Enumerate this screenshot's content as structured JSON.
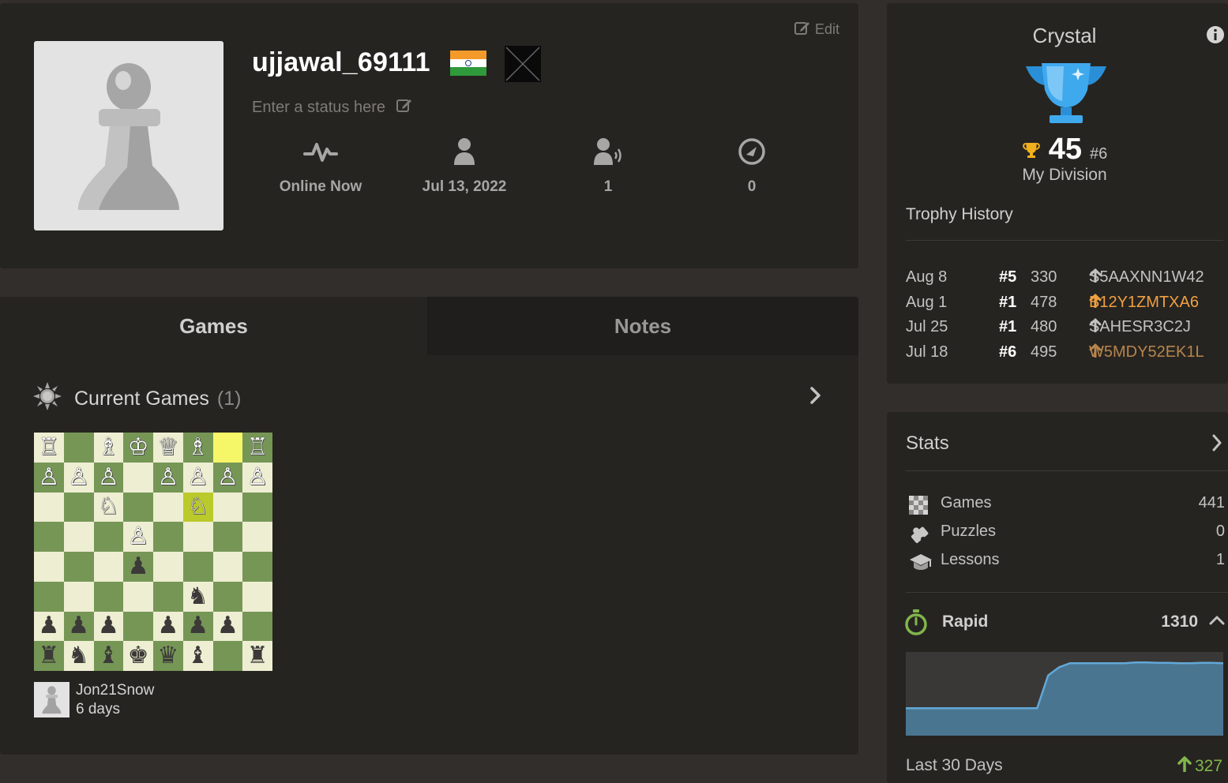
{
  "profile": {
    "edit_label": "Edit",
    "username": "ujjawal_69111",
    "status_placeholder": "Enter a status here",
    "stats": [
      {
        "icon": "activity-icon",
        "value": "Online Now"
      },
      {
        "icon": "joined-user-icon",
        "value": "Jul 13, 2022"
      },
      {
        "icon": "followers-icon",
        "value": "1"
      },
      {
        "icon": "views-icon",
        "value": "0"
      }
    ]
  },
  "tabs": {
    "games": "Games",
    "notes": "Notes"
  },
  "current_games": {
    "title": "Current Games",
    "count": "(1)",
    "opponent": "Jon21Snow",
    "time_left": "6 days",
    "board_rows": [
      "R.BKQB.R",
      "PPP.PPPP",
      "..N..N..",
      "...P....",
      "...p....",
      ".....n..",
      "ppp.ppp.",
      "rnbkqb.r"
    ],
    "highlight_squares": [
      [
        0,
        6
      ],
      [
        2,
        5
      ]
    ]
  },
  "league": {
    "name": "Crystal",
    "points": "45",
    "place": "#6",
    "division_label": "My Division",
    "history_title": "Trophy History",
    "history": [
      {
        "date": "Aug 8",
        "place": "#5",
        "score": "330",
        "code": "S5AAXNN1W42",
        "color": "#c3c2c1"
      },
      {
        "date": "Aug 1",
        "place": "#1",
        "score": "478",
        "code": "B12Y1ZMTXA6",
        "color": "#f0a040"
      },
      {
        "date": "Jul 25",
        "place": "#1",
        "score": "480",
        "code": "SAHESR3C2J",
        "color": "#c3c2c1"
      },
      {
        "date": "Jul 18",
        "place": "#6",
        "score": "495",
        "code": "W5MDY52EK1L",
        "color": "#b7854c"
      }
    ]
  },
  "stats": {
    "title": "Stats",
    "rows": [
      {
        "icon": "checkerboard-icon",
        "label": "Games",
        "value": "441"
      },
      {
        "icon": "puzzle-icon",
        "label": "Puzzles",
        "value": "0"
      },
      {
        "icon": "graduation-cap-icon",
        "label": "Lessons",
        "value": "1"
      }
    ],
    "rapid_label": "Rapid",
    "rapid_rating": "1310",
    "rating_series": [
      1000,
      1000,
      1000,
      1000,
      1000,
      1000,
      1000,
      1000,
      1000,
      1000,
      1000,
      1000,
      1000,
      1080,
      1100,
      1110,
      1110,
      1110,
      1110,
      1110,
      1110,
      1112,
      1112,
      1111,
      1111,
      1110,
      1110,
      1111,
      1111,
      1110
    ],
    "last30_label": "Last 30 Days",
    "last30_change": "327",
    "accent": "#81b64c",
    "chart_line_color": "#62a8d8",
    "chart_fill_color": "#4a7590"
  }
}
